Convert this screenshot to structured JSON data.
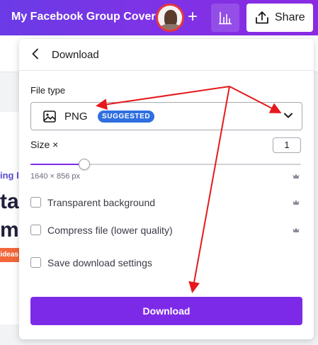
{
  "topbar": {
    "title": "My Facebook Group Cover",
    "plus_label": "+",
    "share_label": "Share",
    "gradient": [
      "#6a3be6",
      "#8a2be2"
    ]
  },
  "background": {
    "fragment_1": "ing I",
    "fragment_2": "tal",
    "fragment_3": "mu",
    "fragment_4": "ideas"
  },
  "panel": {
    "back_icon": "chevron-left-icon",
    "title": "Download",
    "file_type_label": "File type",
    "file_type_value": "PNG",
    "file_type_badge": "SUGGESTED",
    "file_type_icon": "image-icon",
    "size_label": "Size ×",
    "size_value": "1",
    "size_slider_fraction": 0.2,
    "dimensions": "1640 × 856 px",
    "options": [
      {
        "label": "Transparent background",
        "checked": false,
        "premium": true
      },
      {
        "label": "Compress file (lower quality)",
        "checked": false,
        "premium": true
      },
      {
        "label": "Save download settings",
        "checked": false,
        "premium": false
      }
    ],
    "download_label": "Download",
    "accent": "#7d2ae8",
    "badge_color": "#2f6fe0"
  },
  "annotation": {
    "arrow_color": "#e5191c"
  }
}
